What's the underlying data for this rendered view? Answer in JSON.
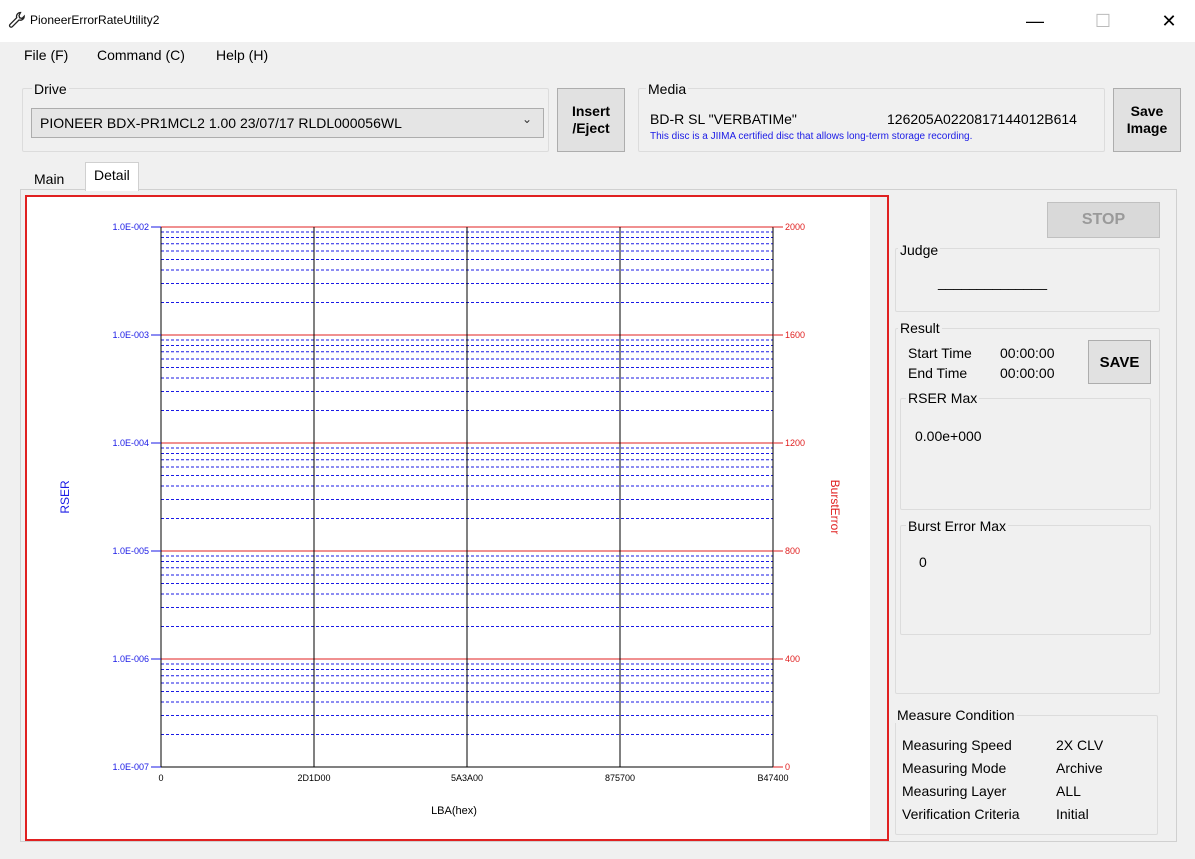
{
  "window": {
    "title": "PioneerErrorRateUtility2",
    "controls": {
      "minimize": "—",
      "maximize": "☐",
      "close": "✕"
    }
  },
  "menu": {
    "file": "File (F)",
    "command": "Command (C)",
    "help": "Help (H)"
  },
  "drive": {
    "label": "Drive",
    "selected": "PIONEER BDX-PR1MCL2   1.00 23/07/17  RLDL000056WL",
    "insert_eject_line1": "Insert",
    "insert_eject_line2": "/Eject"
  },
  "media": {
    "label": "Media",
    "name": "BD-R SL \"VERBATIMe\"",
    "id": "126205A0220817144012B614",
    "note": "This disc is a JIIMA certified disc that allows long-term storage recording.",
    "save_image_line1": "Save",
    "save_image_line2": "Image"
  },
  "tabs": [
    {
      "label": "Main"
    },
    {
      "label": "Detail"
    }
  ],
  "colors": {
    "rser": "#1a1ae6",
    "burst": "#e02020",
    "frame": "#e02020",
    "vertical_grid": "#000000"
  },
  "chart_data": {
    "type": "line",
    "title": "",
    "xlabel": "LBA(hex)",
    "ylabel_left": "RSER",
    "ylabel_right": "BurstError",
    "x_ticks": [
      "0",
      "2D1D00",
      "5A3A00",
      "875700",
      "B47400"
    ],
    "y_left_ticks": [
      "1.0E-002",
      "1.0E-003",
      "1.0E-004",
      "1.0E-005",
      "1.0E-006",
      "1.0E-007"
    ],
    "y_left_scale": "log",
    "y_left_range": [
      1e-07,
      0.01
    ],
    "y_right_ticks": [
      "2000",
      "1600",
      "1200",
      "800",
      "400",
      "0"
    ],
    "y_right_range": [
      0,
      2000
    ],
    "grid": true,
    "series": []
  },
  "controls": {
    "stop": "STOP",
    "save": "SAVE"
  },
  "judge": {
    "label": "Judge",
    "value": "______________"
  },
  "result": {
    "label": "Result",
    "start_time_label": "Start Time",
    "start_time": "00:00:00",
    "end_time_label": "End Time",
    "end_time": "00:00:00",
    "rser_max_label": "RSER Max",
    "rser_max": "0.00e+000",
    "burst_max_label": "Burst Error Max",
    "burst_max": "0"
  },
  "measure_condition": {
    "label": "Measure Condition",
    "rows": [
      {
        "label": "Measuring Speed",
        "value": "2X CLV"
      },
      {
        "label": "Measuring Mode",
        "value": "Archive"
      },
      {
        "label": "Measuring Layer",
        "value": "ALL"
      },
      {
        "label": "Verification Criteria",
        "value": "Initial"
      }
    ]
  }
}
